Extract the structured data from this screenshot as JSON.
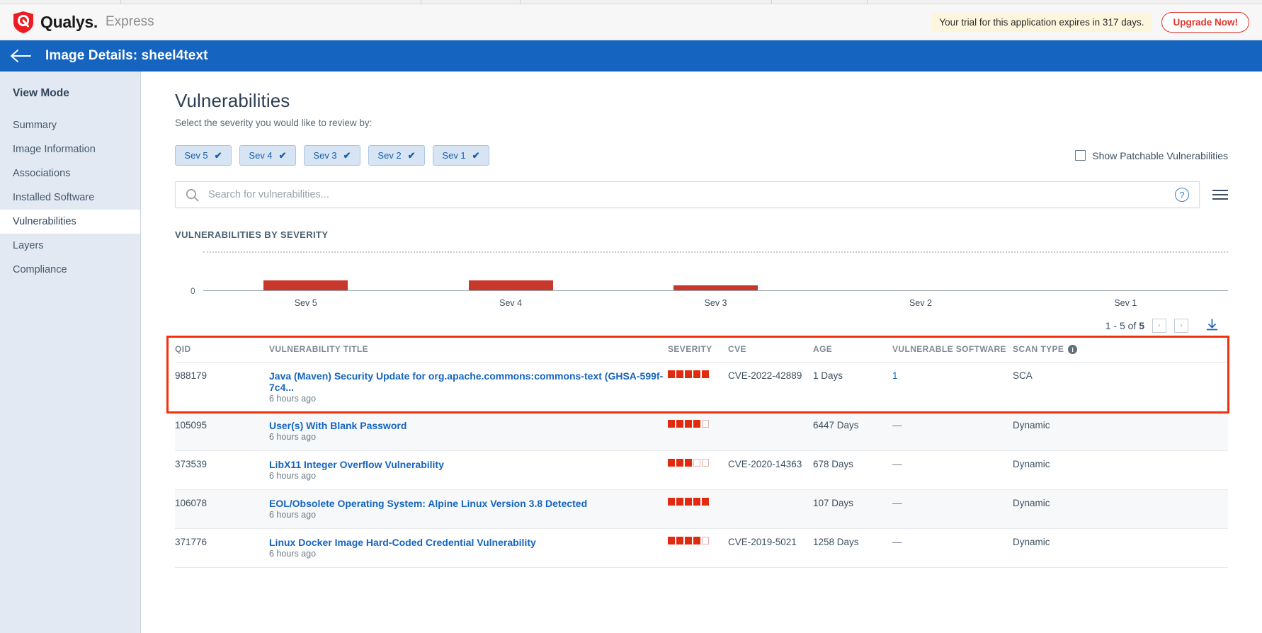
{
  "brand": {
    "name": "Qualys.",
    "edition": "Express",
    "logo_icon": "qualys-shield-icon"
  },
  "trial": {
    "message": "Your trial for this application expires in 317 days.",
    "upgrade_label": "Upgrade Now!",
    "accent_color": "#e0362c",
    "banner_bg": "#fdf6dd"
  },
  "page_header": {
    "back_icon": "back-arrow-icon",
    "title": "Image Details: sheel4text",
    "bg_color": "#1565c0"
  },
  "sidebar": {
    "title": "View Mode",
    "items": [
      {
        "label": "Summary",
        "active": false
      },
      {
        "label": "Image Information",
        "active": false
      },
      {
        "label": "Associations",
        "active": false
      },
      {
        "label": "Installed Software",
        "active": false
      },
      {
        "label": "Vulnerabilities",
        "active": true
      },
      {
        "label": "Layers",
        "active": false
      },
      {
        "label": "Compliance",
        "active": false
      }
    ]
  },
  "main": {
    "title": "Vulnerabilities",
    "subtitle": "Select the severity you would like to review by:",
    "severity_filters": [
      {
        "label": "Sev 5",
        "checked": true,
        "check_glyph": "✔"
      },
      {
        "label": "Sev 4",
        "checked": true,
        "check_glyph": "✔"
      },
      {
        "label": "Sev 3",
        "checked": true,
        "check_glyph": "✔"
      },
      {
        "label": "Sev 2",
        "checked": true,
        "check_glyph": "✔"
      },
      {
        "label": "Sev 1",
        "checked": true,
        "check_glyph": "✔"
      }
    ],
    "patchable": {
      "label": "Show Patchable Vulnerabilities",
      "checked": false,
      "icon": "checkbox-icon"
    },
    "search": {
      "placeholder": "Search for vulnerabilities...",
      "value": "",
      "search_icon": "search-icon",
      "help_icon": "help-circle-icon",
      "help_glyph": "?",
      "menu_icon": "hamburger-menu-icon"
    }
  },
  "chart_data": {
    "type": "bar",
    "title": "VULNERABILITIES BY SEVERITY",
    "categories": [
      "Sev 5",
      "Sev 4",
      "Sev 3",
      "Sev 2",
      "Sev 1"
    ],
    "values": [
      2,
      2,
      1,
      0,
      0
    ],
    "xlabel": "",
    "ylabel": "",
    "ytick_labels": [
      "0"
    ],
    "ylim": [
      0,
      4
    ],
    "grid": true,
    "legend": false,
    "bar_color": "#c8372c"
  },
  "pagination": {
    "range_prefix": "1 - 5 of ",
    "total": "5",
    "prev_glyph": "‹",
    "next_glyph": "›",
    "prev_icon": "chevron-left-icon",
    "next_icon": "chevron-right-icon",
    "download_icon": "download-icon"
  },
  "table": {
    "columns": [
      "QID",
      "VULNERABILITY TITLE",
      "SEVERITY",
      "CVE",
      "AGE",
      "VULNERABLE SOFTWARE",
      "SCAN TYPE"
    ],
    "scan_type_info_glyph": "i",
    "rows": [
      {
        "qid": "988179",
        "title": "Java (Maven) Security Update for org.apache.commons:commons-text (GHSA-599f-7c4...",
        "age_detected": "6 hours ago",
        "severity": 5,
        "cve": "CVE-2022-42889",
        "age": "1 Days",
        "vulnerable_software": "1",
        "vulnerable_software_is_link": true,
        "scan_type": "SCA",
        "highlighted": true
      },
      {
        "qid": "105095",
        "title": "User(s) With Blank Password",
        "age_detected": "6 hours ago",
        "severity": 4,
        "cve": "",
        "age": "6447 Days",
        "vulnerable_software": "—",
        "vulnerable_software_is_link": false,
        "scan_type": "Dynamic",
        "highlighted": false
      },
      {
        "qid": "373539",
        "title": "LibX11 Integer Overflow Vulnerability",
        "age_detected": "6 hours ago",
        "severity": 3,
        "cve": "CVE-2020-14363",
        "age": "678 Days",
        "vulnerable_software": "—",
        "vulnerable_software_is_link": false,
        "scan_type": "Dynamic",
        "highlighted": false
      },
      {
        "qid": "106078",
        "title": "EOL/Obsolete Operating System: Alpine Linux Version 3.8 Detected",
        "age_detected": "6 hours ago",
        "severity": 5,
        "cve": "",
        "age": "107 Days",
        "vulnerable_software": "—",
        "vulnerable_software_is_link": false,
        "scan_type": "Dynamic",
        "highlighted": false
      },
      {
        "qid": "371776",
        "title": "Linux Docker Image Hard-Coded Credential Vulnerability",
        "age_detected": "6 hours ago",
        "severity": 4,
        "cve": "CVE-2019-5021",
        "age": "1258 Days",
        "vulnerable_software": "—",
        "vulnerable_software_is_link": false,
        "scan_type": "Dynamic",
        "highlighted": false
      }
    ]
  },
  "colors": {
    "severity_red": "#e02b10",
    "chart_red": "#c8372c",
    "link_blue": "#1565c0",
    "highlight_outline": "#f3300c",
    "sidebar_bg": "#e3e9f2"
  }
}
